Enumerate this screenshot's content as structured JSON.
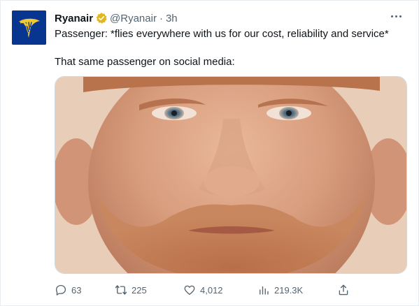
{
  "tweet": {
    "author_name": "Ryanair",
    "handle": "@Ryanair",
    "separator": "·",
    "time": "3h",
    "line1": "Passenger: *flies everywhere with us for our cost, reliability and service*",
    "line2": "That same passenger on social media:",
    "media_description_icon": "photo-of-man-face"
  },
  "actions": {
    "reply_count": "63",
    "retweet_count": "225",
    "like_count": "4,012",
    "views_count": "219.3K"
  },
  "colors": {
    "brand_blue": "#073590",
    "brand_yellow": "#f1c933",
    "verified_gold": "#e2b719",
    "muted_text": "#536471"
  }
}
